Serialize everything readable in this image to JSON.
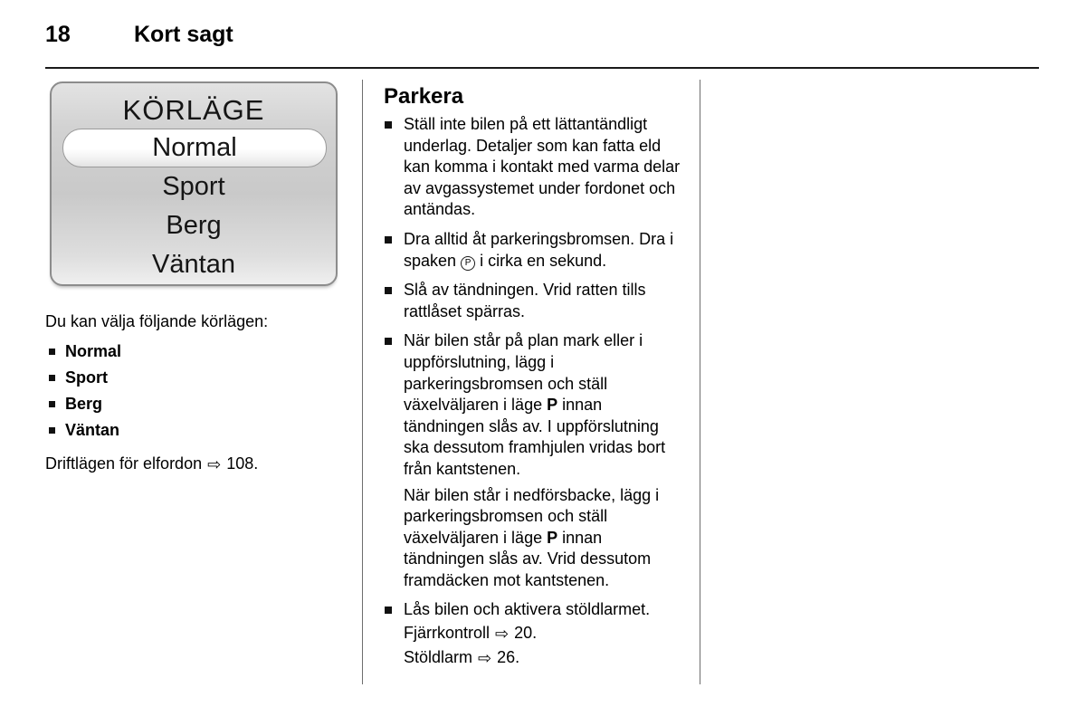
{
  "header": {
    "page_number": "18",
    "chapter": "Kort sagt"
  },
  "illustration": {
    "name": "drive-mode-display",
    "title": "KÖRLÄGE",
    "selected": "Normal",
    "rows": [
      {
        "label": "Normal",
        "selected": true
      },
      {
        "label": "Sport",
        "selected": false
      },
      {
        "label": "Berg",
        "selected": false
      },
      {
        "label": "Väntan",
        "selected": false
      }
    ],
    "colors": {
      "panel_border": "#8c8c8c",
      "panel_bg_top": "#e3e3e3",
      "panel_bg_bottom": "#efefef",
      "selected_bg": "#ffffff",
      "text": "#151515"
    }
  },
  "left_column": {
    "intro": "Du kan välja följande körlägen:",
    "modes": [
      "Normal",
      "Sport",
      "Berg",
      "Väntan"
    ],
    "reference": {
      "text": "Driftlägen för elfordon",
      "arrow": "⇨",
      "page": "108."
    }
  },
  "middle_column": {
    "heading": "Parkera",
    "bullets": [
      {
        "text": "Ställ inte bilen på ett lättantändligt underlag. Detaljer som kan fatta eld kan komma i kontakt med varma delar av avgassystemet under fordonet och antändas."
      },
      {
        "text": "Dra alltid åt parkeringsbromsen. Dra i spaken",
        "inline_symbol": "P",
        "text_after": "i cirka en sekund."
      },
      {
        "text": "Slå av tändningen. Vrid ratten tills rattlåset spärras."
      },
      {
        "text_part1": "När bilen står på plan mark eller i uppförslutning, lägg i parkeringsbromsen och ställ växelväljaren i läge",
        "bold": "P",
        "text_part2": "innan tändningen slås av. I uppförslutning ska dessutom framhjulen vridas bort från kantstenen.",
        "sub_paragraph_part1": "När bilen står i nedförsbacke, lägg i parkeringsbromsen och ställ växelväljaren i läge",
        "sub_bold": "P",
        "sub_paragraph_part2": "innan tändningen slås av. Vrid dessutom framdäcken mot kantstenen."
      },
      {
        "text": "Lås bilen och aktivera stöldlarmet.",
        "refs": [
          {
            "text": "Fjärrkontroll",
            "arrow": "⇨",
            "page": "20."
          },
          {
            "text": "Stöldlarm",
            "arrow": "⇨",
            "page": "26."
          }
        ]
      }
    ]
  }
}
